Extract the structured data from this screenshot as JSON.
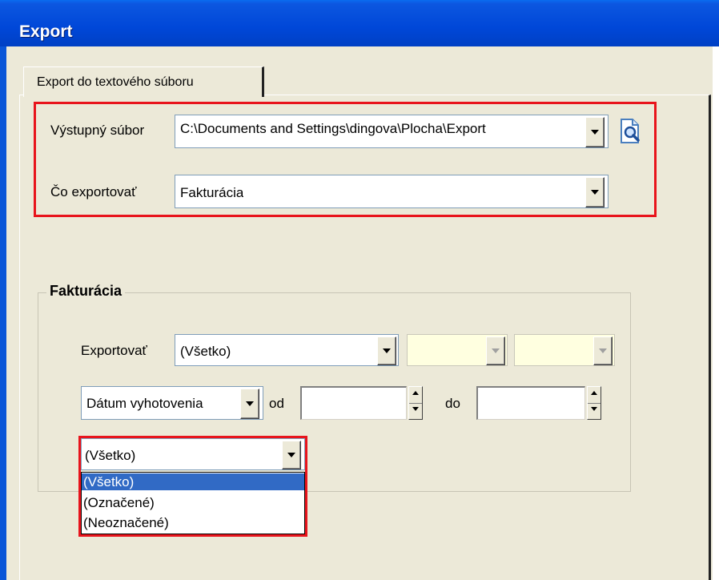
{
  "window": {
    "title": "Export"
  },
  "tabs": [
    {
      "label": "Export do textového súboru"
    }
  ],
  "output": {
    "label": "Výstupný súbor",
    "value": "C:\\Documents and Settings\\dingova\\Plocha\\Export",
    "browse_icon": "browse-magnifier-icon"
  },
  "what": {
    "label": "Čo exportovať",
    "value": "Fakturácia"
  },
  "group": {
    "title": "Fakturácia",
    "export_label": "Exportovať",
    "export_value": "(Všetko)",
    "date_type_value": "Dátum vyhotovenia",
    "from_label": "od",
    "from_value": "",
    "to_label": "do",
    "to_value": "",
    "filter_value": "(Všetko)",
    "filter_options": [
      "(Všetko)",
      "(Označené)",
      "(Neoznačené)"
    ],
    "filter_selected_index": 0
  },
  "colors": {
    "highlight": "#e8141c",
    "selection": "#316ac5",
    "titlebar": "#0047d8",
    "disabled_field": "#ffffe0"
  }
}
